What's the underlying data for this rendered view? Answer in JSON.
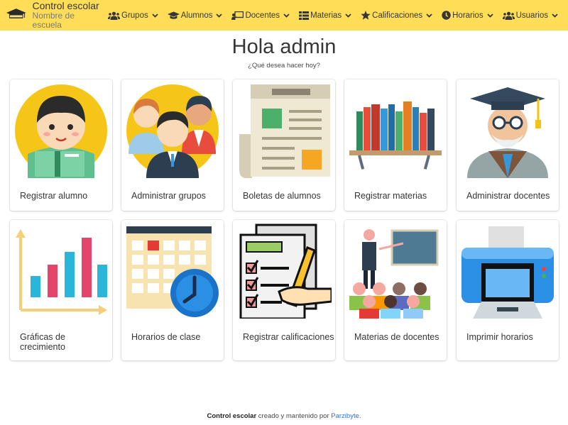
{
  "brand": {
    "title": "Control escolar",
    "subtitle": "Nombre de escuela",
    "logo_text": "CONTROL ESCOLAR"
  },
  "nav": [
    {
      "label": "Grupos",
      "icon": "users-icon"
    },
    {
      "label": "Alumnos",
      "icon": "graduation-cap-icon"
    },
    {
      "label": "Docentes",
      "icon": "chalkboard-teacher-icon"
    },
    {
      "label": "Materias",
      "icon": "th-list-icon"
    },
    {
      "label": "Calificaciones",
      "icon": "star-icon"
    },
    {
      "label": "Horarios",
      "icon": "clock-icon"
    },
    {
      "label": "Usuarios",
      "icon": "users-icon"
    }
  ],
  "hero": {
    "title": "Hola admin",
    "subtitle": "¿Qué desea hacer hoy?"
  },
  "cards": [
    {
      "label": "Registrar alumno",
      "icon": "student-icon"
    },
    {
      "label": "Administrar grupos",
      "icon": "group-icon"
    },
    {
      "label": "Boletas de alumnos",
      "icon": "newspaper-icon"
    },
    {
      "label": "Registrar materias",
      "icon": "books-icon"
    },
    {
      "label": "Administrar docentes",
      "icon": "teacher-icon"
    },
    {
      "label": "Gráficas de crecimiento",
      "icon": "bar-chart-icon"
    },
    {
      "label": "Horarios de clase",
      "icon": "calendar-clock-icon"
    },
    {
      "label": "Registrar calificaciones",
      "icon": "checklist-icon"
    },
    {
      "label": "Materias de docentes",
      "icon": "classroom-icon"
    },
    {
      "label": "Imprimir horarios",
      "icon": "printer-icon"
    }
  ],
  "footer": {
    "brand": "Control escolar",
    "text": " creado y mantenido por ",
    "author": "Parzibyte",
    "end": "."
  },
  "colors": {
    "navbar": "#ffdd57",
    "link": "#3273dc"
  }
}
